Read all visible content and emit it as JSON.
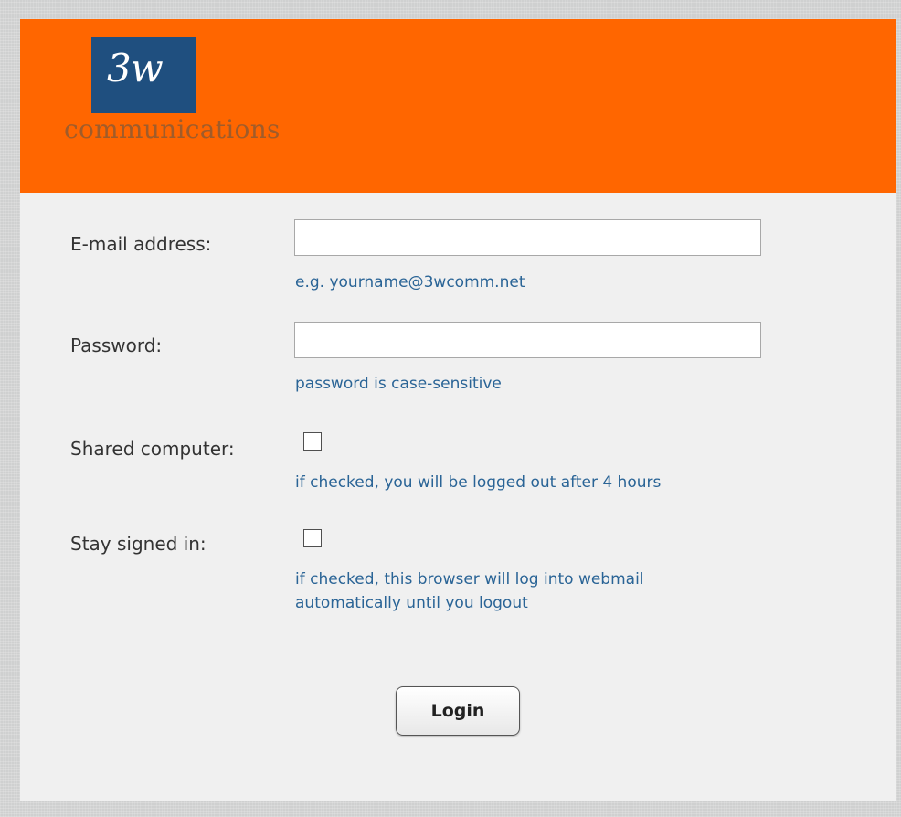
{
  "logo": {
    "mark": "3w",
    "wordmark": "communications"
  },
  "colors": {
    "header": "#ff6600",
    "logo_box": "#1f4f7f",
    "hint_text": "#2a6496",
    "panel": "#f0f0f0"
  },
  "form": {
    "email": {
      "label": "E-mail address:",
      "value": "",
      "hint": "e.g. yourname@3wcomm.net"
    },
    "password": {
      "label": "Password:",
      "value": "",
      "hint": "password is case-sensitive"
    },
    "shared_computer": {
      "label": "Shared computer:",
      "checked": false,
      "hint": "if checked, you will be logged out after 4 hours"
    },
    "stay_signed_in": {
      "label": "Stay signed in:",
      "checked": false,
      "hint_line1": "if checked, this browser will log into webmail",
      "hint_line2": "automatically until you logout"
    },
    "login_label": "Login"
  }
}
